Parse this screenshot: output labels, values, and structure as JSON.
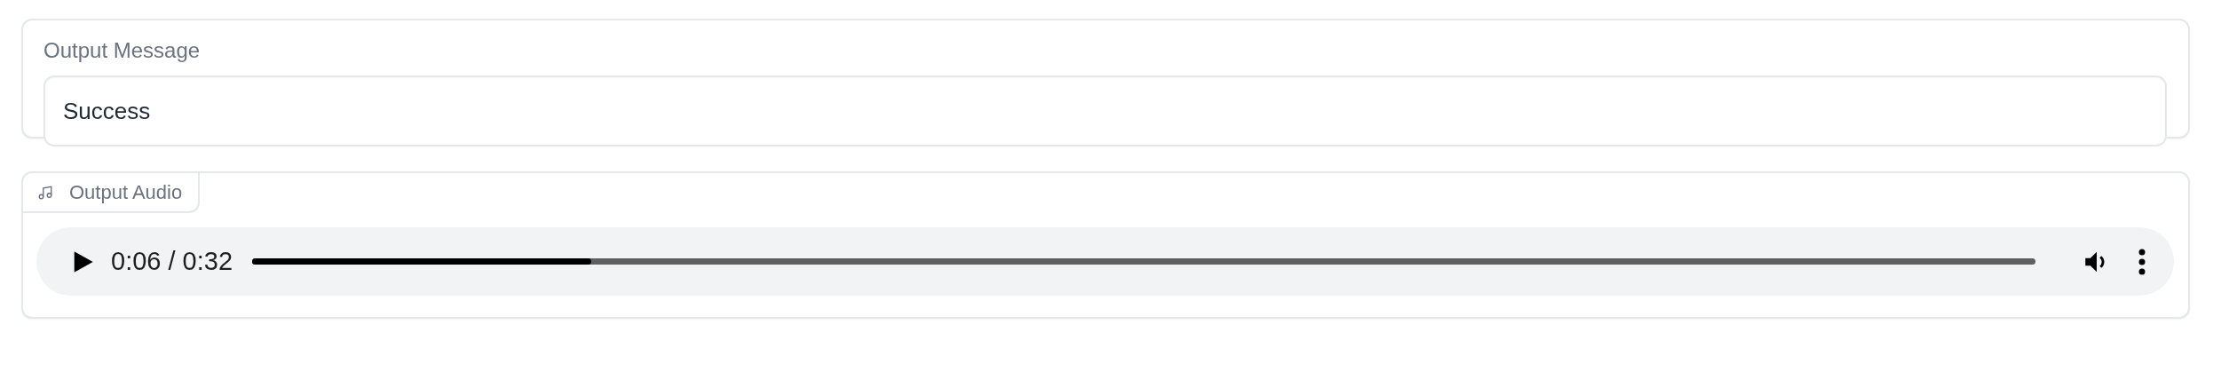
{
  "output_message": {
    "label": "Output Message",
    "value": "Success"
  },
  "output_audio": {
    "label": "Output Audio",
    "player": {
      "time": "0:06 / 0:32",
      "level": 0.19
    }
  }
}
